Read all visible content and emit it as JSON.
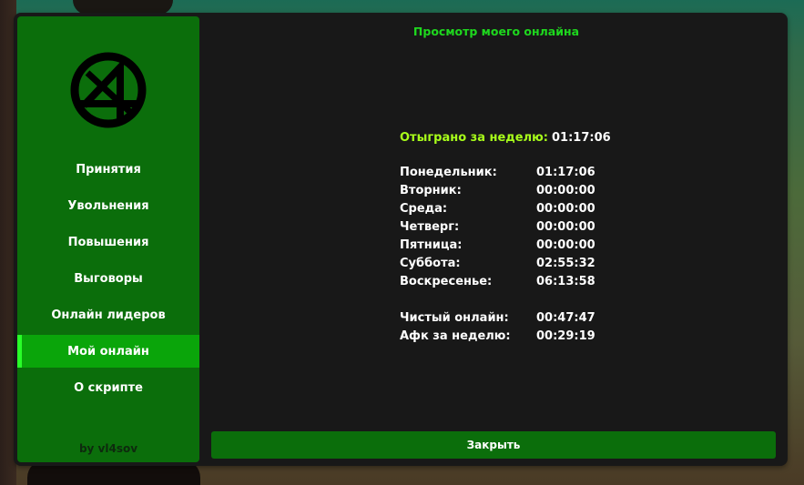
{
  "title": "Просмотр моего онлайна",
  "sidebar": {
    "items": [
      {
        "label": "Принятия"
      },
      {
        "label": "Увольнения"
      },
      {
        "label": "Повышения"
      },
      {
        "label": "Выговоры"
      },
      {
        "label": "Онлайн лидеров"
      },
      {
        "label": "Мой онлайн"
      },
      {
        "label": "О скрипте"
      }
    ],
    "active_item": "Мой онлайн",
    "author": "by vl4sov"
  },
  "stats": {
    "week_label": "Отыграно за неделю:",
    "week_value": "01:17:06",
    "days": [
      {
        "label": "Понедельник:",
        "value": "01:17:06"
      },
      {
        "label": "Вторник:",
        "value": "00:00:00"
      },
      {
        "label": "Среда:",
        "value": "00:00:00"
      },
      {
        "label": "Четверг:",
        "value": "00:00:00"
      },
      {
        "label": "Пятница:",
        "value": "00:00:00"
      },
      {
        "label": "Суббота:",
        "value": "02:55:32"
      },
      {
        "label": "Воскресенье:",
        "value": "06:13:58"
      }
    ],
    "clean_label": "Чистый онлайн:",
    "clean_value": "00:47:47",
    "afk_label": "Афк за неделю:",
    "afk_value": "00:29:19"
  },
  "close_label": "Закрыть",
  "colors": {
    "accent_green": "#0b6e0b",
    "active_green": "#0aa50a",
    "title_green": "#1ed81e",
    "week_label_lime": "#a8ff1a",
    "window_bg": "#181818"
  },
  "icons": {
    "logo": "anarchy-style-logo-icon"
  }
}
